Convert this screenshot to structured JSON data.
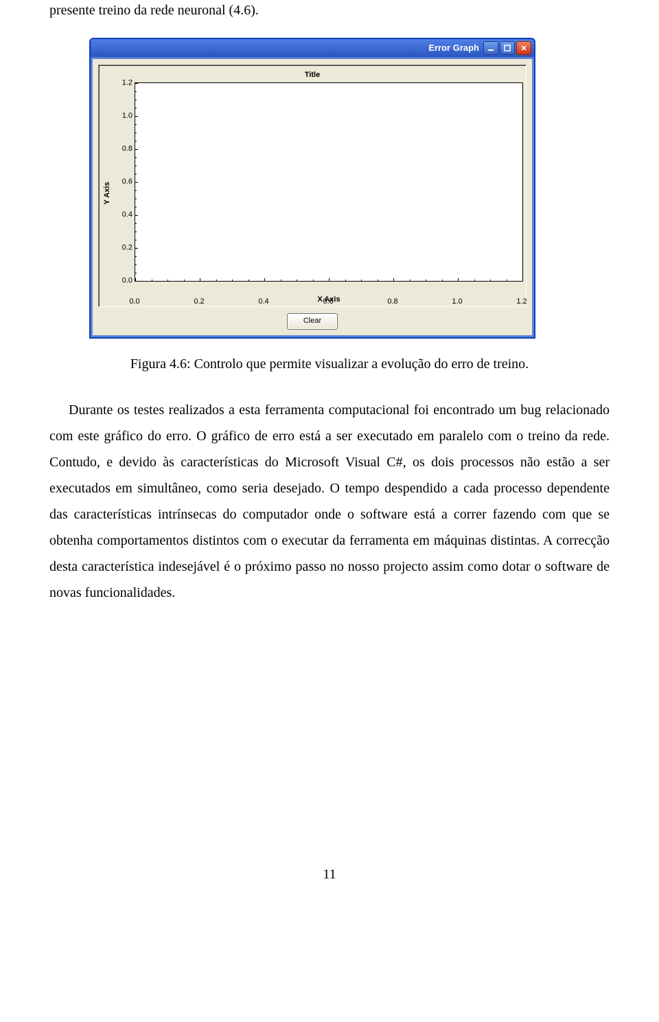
{
  "intro": "presente treino da rede neuronal (4.6).",
  "window": {
    "title": "Error Graph",
    "clear_button": "Clear"
  },
  "chart_data": {
    "type": "line",
    "title": "Title",
    "xlabel": "X Axis",
    "ylabel": "Y Axis",
    "xlim": [
      0.0,
      1.2
    ],
    "ylim": [
      0.0,
      1.2
    ],
    "x_ticks": [
      0.0,
      0.2,
      0.4,
      0.6,
      0.8,
      1.0,
      1.2
    ],
    "y_ticks": [
      0.0,
      0.2,
      0.4,
      0.6,
      0.8,
      1.0,
      1.2
    ],
    "x_tick_labels": [
      "0.0",
      "0.2",
      "0.4",
      "0.6",
      "0.8",
      "1.0",
      "1.2"
    ],
    "y_tick_labels": [
      "0.0",
      "0.2",
      "0.4",
      "0.6",
      "0.8",
      "1.0",
      "1.2"
    ],
    "series": []
  },
  "caption": "Figura 4.6: Controlo que permite visualizar a evolução do erro de treino.",
  "body_text": "Durante os testes realizados a esta ferramenta computacional foi encontrado um bug relacionado com este gráfico do erro. O gráfico de erro está a ser executado em paralelo com o treino da rede. Contudo, e devido às características do Microsoft Visual C#, os dois processos não estão a ser executados em simultâneo, como seria desejado. O tempo despendido a cada processo dependente das características intrínsecas do computador onde o software está a correr fazendo com que se obtenha comportamentos distintos com o executar da ferramenta em máquinas distintas. A correcção desta característica indesejável é o próximo passo no nosso projecto assim como dotar o software de novas funcionalidades.",
  "page_number": "11"
}
